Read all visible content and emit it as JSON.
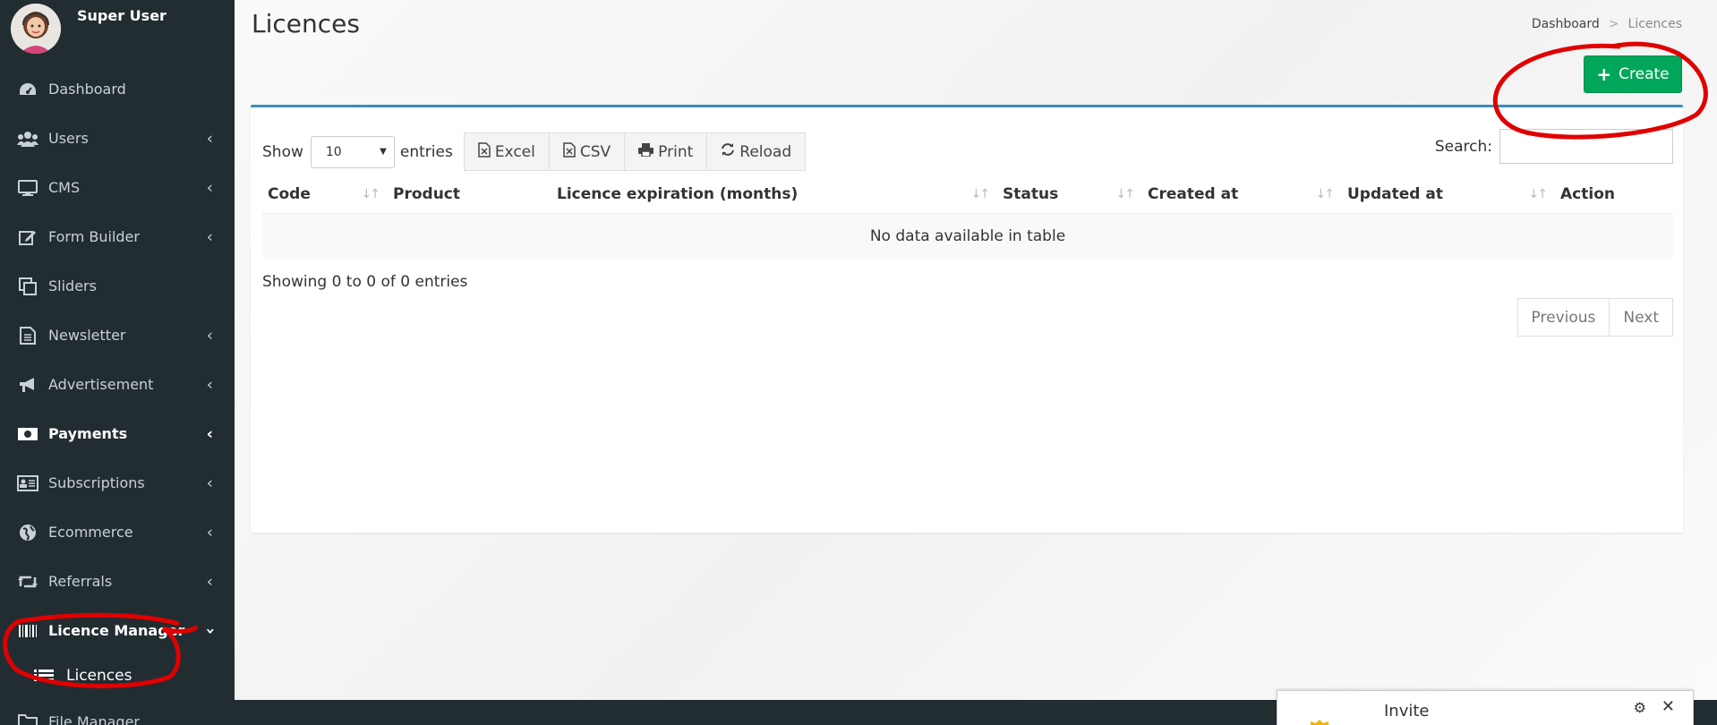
{
  "user": {
    "name": "Super User"
  },
  "sidebar": {
    "items": [
      {
        "label": "Dashboard",
        "icon": "dashboard-icon",
        "chevron": false
      },
      {
        "label": "Users",
        "icon": "users-icon",
        "chevron": true
      },
      {
        "label": "CMS",
        "icon": "desktop-icon",
        "chevron": true
      },
      {
        "label": "Form Builder",
        "icon": "edit-icon",
        "chevron": true
      },
      {
        "label": "Sliders",
        "icon": "copy-icon",
        "chevron": false
      },
      {
        "label": "Newsletter",
        "icon": "file-text-icon",
        "chevron": true
      },
      {
        "label": "Advertisement",
        "icon": "bullhorn-icon",
        "chevron": true
      },
      {
        "label": "Payments",
        "icon": "money-icon",
        "chevron": true
      },
      {
        "label": "Subscriptions",
        "icon": "id-card-icon",
        "chevron": true
      },
      {
        "label": "Ecommerce",
        "icon": "globe-icon",
        "chevron": true
      },
      {
        "label": "Referrals",
        "icon": "retweet-icon",
        "chevron": true
      },
      {
        "label": "Licence Manager",
        "icon": "barcode-icon",
        "chevron": true
      }
    ],
    "submenu": [
      {
        "label": "Licences",
        "icon": "list-icon"
      }
    ],
    "last_item": {
      "label": "File Manager",
      "icon": "folder-icon"
    }
  },
  "page": {
    "title": "Licences"
  },
  "breadcrumb": {
    "home": "Dashboard",
    "separator": ">",
    "current": "Licences"
  },
  "create_button": {
    "label": "Create"
  },
  "table_controls": {
    "show_label": "Show",
    "entries_value": "10",
    "entries_label": "entries",
    "buttons": [
      "Excel",
      "CSV",
      "Print",
      "Reload"
    ],
    "search_label": "Search:"
  },
  "table": {
    "columns": [
      "Code",
      "Product",
      "Licence expiration (months)",
      "Status",
      "Created at",
      "Updated at",
      "Action"
    ],
    "empty_message": "No data available in table",
    "info": "Showing 0 to 0 of 0 entries"
  },
  "pagination": {
    "previous": "Previous",
    "next": "Next"
  },
  "invite": {
    "label": "Invite"
  },
  "colors": {
    "sidebar": "#222d32",
    "accent": "#3c8dbc",
    "create": "#00a65a",
    "annotation": "#e00000"
  }
}
